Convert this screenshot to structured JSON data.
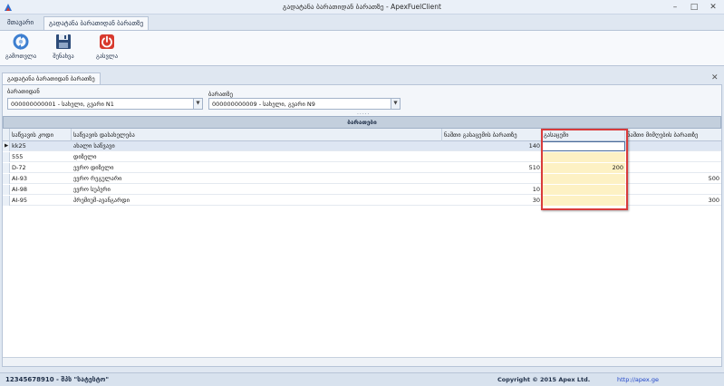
{
  "window": {
    "title": "გადატანა ბარათიდან ბარათზე - ApexFuelClient",
    "minimize": "–",
    "maximize": "□",
    "close": "✕"
  },
  "ribbon": {
    "tabs": [
      {
        "label": "მთავარი"
      },
      {
        "label": "გადატანა ბარათიდან ბარათზე"
      }
    ],
    "buttons": [
      {
        "label": "გამოთვლა",
        "icon": "refresh-calc-icon"
      },
      {
        "label": "შენახვა",
        "icon": "floppy-save-icon"
      },
      {
        "label": "გასვლა",
        "icon": "power-exit-icon"
      }
    ]
  },
  "document": {
    "tab_label": "გადატანა ბარათიდან ბარათზე",
    "close": "✕"
  },
  "form": {
    "from_label": "ბარათიდან",
    "from_value": "000000000001 - სახელი, გვარი N1",
    "to_label": "ბარათზე",
    "to_value": "000000000009 - სახელი, გვარი N9",
    "splitter": "....."
  },
  "grid": {
    "group_title": "ბარათები",
    "columns": [
      "საწვავის კოდი",
      "საწვავის დასახელება",
      "ნაშთი გასაცემის ბარათზე",
      "გასაცემი",
      "ნაშთი მიმღების ბარათზე"
    ],
    "rows": [
      {
        "code": "kk25",
        "name": "ახალი საწვავი",
        "balance_from": "140",
        "transfer": "",
        "balance_to": "",
        "active": true
      },
      {
        "code": "555",
        "name": "დიზელი",
        "balance_from": "",
        "transfer": "",
        "balance_to": "",
        "active": false
      },
      {
        "code": "D-72",
        "name": "ევრო დიზელი",
        "balance_from": "510",
        "transfer": "200",
        "balance_to": "",
        "active": false
      },
      {
        "code": "AI-93",
        "name": "ევრო რეგულარი",
        "balance_from": "",
        "transfer": "",
        "balance_to": "500",
        "active": false
      },
      {
        "code": "AI-98",
        "name": "ევრო სუპერი",
        "balance_from": "10",
        "transfer": "",
        "balance_to": "",
        "active": false
      },
      {
        "code": "AI-95",
        "name": "პრემიუმ-ავანგარდი",
        "balance_from": "30",
        "transfer": "",
        "balance_to": "300",
        "active": false
      }
    ],
    "current_row_marker": "▶"
  },
  "status": {
    "user": "12345678910 - შპს \"სატესტო\"",
    "copyright": "Copyright © 2015 Apex Ltd.",
    "link": "http://apex.ge"
  },
  "colors": {
    "highlight_border": "#d93b3b",
    "editable_cell": "#fdf1c4",
    "exit_red": "#d83a2e",
    "link_blue": "#1f44c8"
  }
}
